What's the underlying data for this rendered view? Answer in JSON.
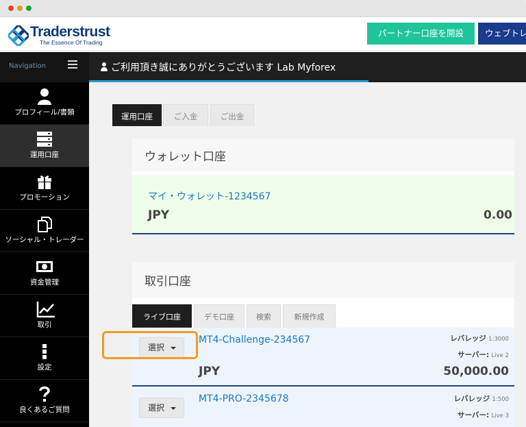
{
  "brand": {
    "name": "Traderstrust",
    "tagline": "The Essence Of Trading",
    "colors": {
      "navy": "#0d3b77",
      "accent_green": "#1fc49b",
      "link": "#1a78c2",
      "highlight": "#f39a22"
    }
  },
  "topbar": {
    "partner_button": "パートナー口座を開設",
    "web_button": "ウェブトレ"
  },
  "nav": {
    "label": "Navigation",
    "menu_icon": "hamburger-icon"
  },
  "header": {
    "title": "ご利用頂き誠にありがとうございます Lab Myforex",
    "icon": "user-icon"
  },
  "sidebar": {
    "items": [
      {
        "label": "プロフィール/書類",
        "icon": "user-icon"
      },
      {
        "label": "運用口座",
        "icon": "server-icon",
        "active": true
      },
      {
        "label": "プロモーション",
        "icon": "gift-icon"
      },
      {
        "label": "ソーシャル・トレーダー",
        "icon": "copy-icon"
      },
      {
        "label": "資金管理",
        "icon": "money-icon"
      },
      {
        "label": "取引",
        "icon": "chart-icon"
      },
      {
        "label": "設定",
        "icon": "ellipsis-vertical-icon"
      },
      {
        "label": "良くあるご質問",
        "icon": "question-icon"
      }
    ]
  },
  "tabs": [
    {
      "label": "運用口座",
      "active": true
    },
    {
      "label": "ご入金",
      "active": false
    },
    {
      "label": "ご出金",
      "active": false
    }
  ],
  "wallet": {
    "title": "ウォレット口座",
    "name": "マイ・ウォレット-1234567",
    "currency": "JPY",
    "balance": "0.00"
  },
  "trading": {
    "title": "取引口座",
    "subtabs": [
      {
        "label": "ライブ口座",
        "active": true
      },
      {
        "label": "デモ口座",
        "active": false
      },
      {
        "label": "検索",
        "active": false
      },
      {
        "label": "新規作成",
        "active": false
      }
    ],
    "select_label": "選択",
    "leverage_label": "レバレッジ",
    "server_label": "サーバー:",
    "accounts": [
      {
        "name": "MT4-Challenge-234567",
        "currency": "JPY",
        "balance": "50,000.00",
        "leverage": "1:3000",
        "server": "Live 2"
      },
      {
        "name": "MT4-PRO-2345678",
        "leverage": "1:500",
        "server": "Live 3"
      }
    ]
  }
}
